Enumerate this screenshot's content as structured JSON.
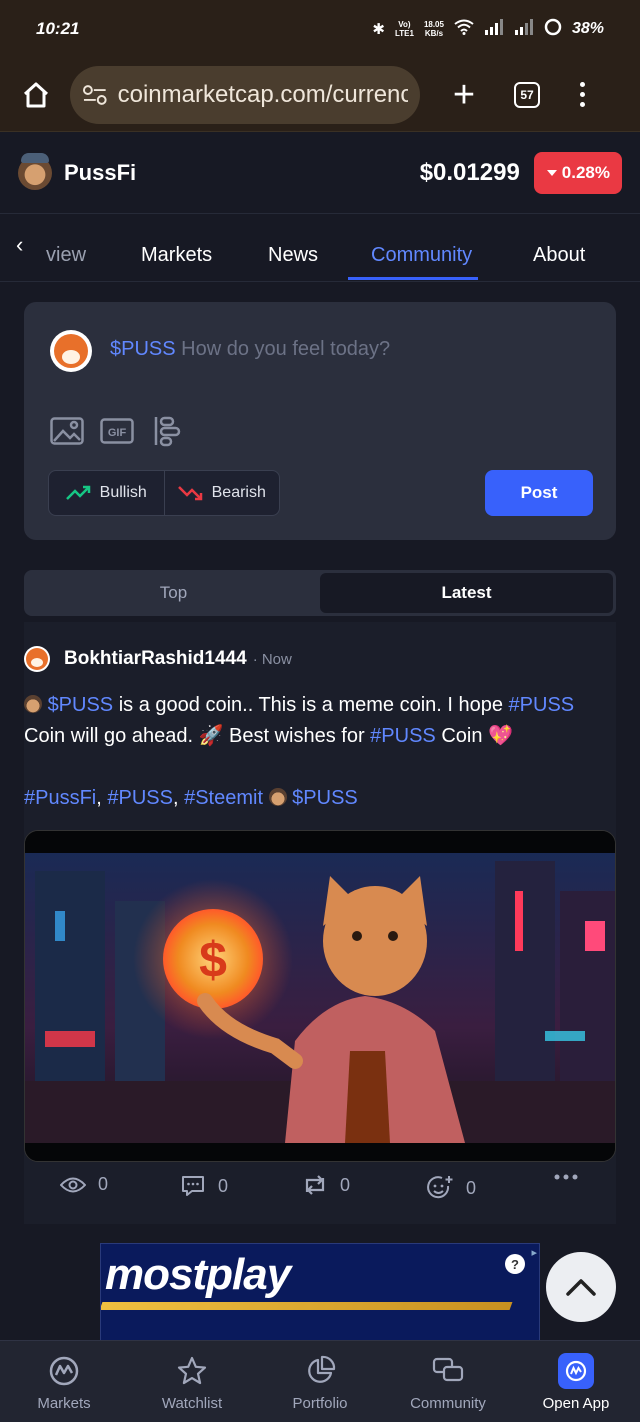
{
  "status_bar": {
    "time": "10:21",
    "net_speed_top": "18.05",
    "net_speed_bottom": "KB/s",
    "lte_top": "Vo)",
    "lte_bottom": "LTE1",
    "battery": "38%"
  },
  "browser": {
    "url": "coinmarketcap.com/currenc",
    "tab_count": "57"
  },
  "coin": {
    "name": "PussFi",
    "price": "$0.01299",
    "change": "0.28%",
    "change_color": "#ea3943"
  },
  "nav_tabs": [
    {
      "label": "view"
    },
    {
      "label": "Markets"
    },
    {
      "label": "News"
    },
    {
      "label": "Community"
    },
    {
      "label": "About"
    }
  ],
  "composer": {
    "ticker": "$PUSS",
    "placeholder": "How do you feel today?",
    "bullish_label": "Bullish",
    "bearish_label": "Bearish",
    "post_label": "Post",
    "gif_label": "GIF"
  },
  "feed_toggle": {
    "top_label": "Top",
    "latest_label": "Latest"
  },
  "post": {
    "username": "BokhtiarRashid1444",
    "time": "· Now",
    "body_ticker": "$PUSS",
    "body_text_1": " is a good coin.. This is a meme coin. I hope ",
    "body_hashtag_1": "#PUSS",
    "body_text_2": " Coin will go ahead. 🚀 Best wishes for ",
    "body_hashtag_2": "#PUSS",
    "body_text_3": " Coin 💖",
    "tags": [
      "#PussFi",
      "#PUSS",
      "#Steemit"
    ],
    "tags_ticker": "$PUSS",
    "views": "0",
    "comments": "0",
    "reposts": "0",
    "reactions": "0"
  },
  "ad": {
    "brand": "mostplay",
    "help": "?"
  },
  "bottom_nav": [
    {
      "label": "Markets"
    },
    {
      "label": "Watchlist"
    },
    {
      "label": "Portfolio"
    },
    {
      "label": "Community"
    },
    {
      "label": "Open App"
    }
  ],
  "colors": {
    "accent": "#3861fb",
    "link": "#6188ff",
    "negative": "#ea3943",
    "positive": "#16c784",
    "background": "#171924"
  }
}
